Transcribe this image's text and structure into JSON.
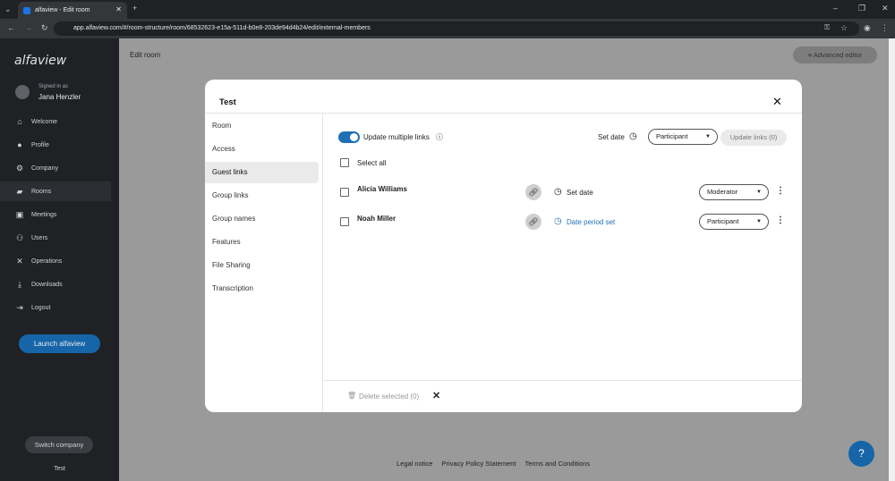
{
  "browser": {
    "tab_title": "alfaview - Edit room",
    "url": "app.alfaview.com/#/room-structure/room/68532623-e15a-511d-b0e8-203de94d4b24/edit/external-members"
  },
  "sidebar": {
    "logo": "alfaview",
    "signed_in_label": "Signed in as",
    "user_name": "Jana Henzler",
    "items": [
      {
        "label": "Welcome",
        "icon": "home-icon"
      },
      {
        "label": "Profile",
        "icon": "person-icon"
      },
      {
        "label": "Company",
        "icon": "gear-icon"
      },
      {
        "label": "Rooms",
        "icon": "folder-icon"
      },
      {
        "label": "Meetings",
        "icon": "calendar-icon"
      },
      {
        "label": "Users",
        "icon": "users-icon"
      },
      {
        "label": "Operations",
        "icon": "tools-icon"
      },
      {
        "label": "Downloads",
        "icon": "download-icon"
      },
      {
        "label": "Logout",
        "icon": "logout-icon"
      }
    ],
    "launch_label": "Launch alfaview",
    "switch_label": "Switch company",
    "company_name": "Test"
  },
  "page": {
    "title": "Edit room",
    "advanced_editor": "Advanced editor",
    "footer": {
      "legal": "Legal notice",
      "privacy": "Privacy Policy Statement",
      "terms": "Terms and Conditions"
    },
    "help_label": "?"
  },
  "modal": {
    "title": "Test",
    "nav": [
      "Room",
      "Access",
      "Guest links",
      "Group links",
      "Group names",
      "Features",
      "File Sharing",
      "Transcription"
    ],
    "active_nav": "Guest links",
    "update_multiple_label": "Update multiple links",
    "set_date_label": "Set date",
    "role_select": "Participant",
    "update_links_label": "Update links (0)",
    "select_all_label": "Select all",
    "rows": [
      {
        "name": "Alicia Williams",
        "date": "Set date",
        "role": "Moderator"
      },
      {
        "name": "Noah Miller",
        "date": "Date period set",
        "role": "Participant"
      }
    ],
    "delete_label": "Delete selected (0)"
  },
  "colors": {
    "accent": "#1f6fb5",
    "sidebar_bg": "#1f2124",
    "link_text": "#1f6fb5"
  }
}
